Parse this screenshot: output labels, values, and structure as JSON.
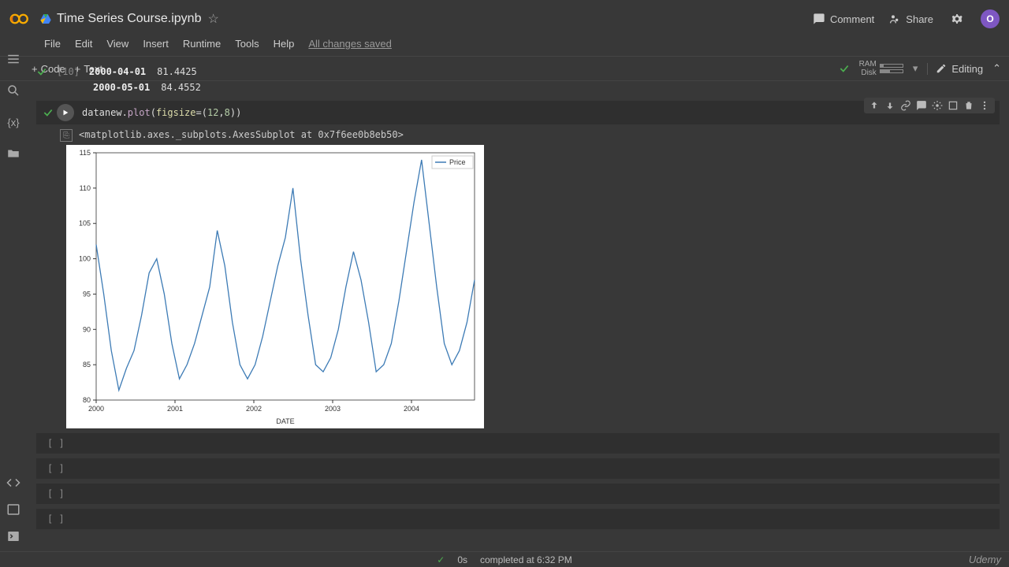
{
  "header": {
    "filename": "Time Series Course.ipynb",
    "comment": "Comment",
    "share": "Share",
    "avatar": "O"
  },
  "menubar": {
    "file": "File",
    "edit": "Edit",
    "view": "View",
    "insert": "Insert",
    "runtime": "Runtime",
    "tools": "Tools",
    "help": "Help",
    "status": "All changes saved"
  },
  "toolbar": {
    "code": "Code",
    "text": "Text",
    "ram": "RAM",
    "disk": "Disk",
    "editing": "Editing"
  },
  "output_rows": [
    {
      "date": "2000-04-01",
      "value": "81.4425"
    },
    {
      "date": "2000-05-01",
      "value": "84.4552"
    }
  ],
  "prev_cell": {
    "exec": "[10]"
  },
  "cell": {
    "code_display": "datanew.plot(figsize=(12,8))",
    "repr": "<matplotlib.axes._subplots.AxesSubplot at 0x7f6ee0b8eb50>"
  },
  "empty_cells": [
    "[ ]",
    "[ ]",
    "[ ]",
    "[ ]"
  ],
  "statusbar": {
    "check": "✓",
    "duration": "0s",
    "completed": "completed at 6:32 PM"
  },
  "watermark": "Udemy",
  "chart_data": {
    "type": "line",
    "xlabel": "DATE",
    "legend": "Price",
    "ylim": [
      80,
      115
    ],
    "yticks": [
      80,
      85,
      90,
      95,
      100,
      105,
      110,
      115
    ],
    "xticks": [
      "2000",
      "2001",
      "2002",
      "2003",
      "2004"
    ],
    "series": [
      {
        "name": "Price",
        "x_fraction": [
          0.0,
          0.02,
          0.04,
          0.06,
          0.08,
          0.1,
          0.12,
          0.14,
          0.16,
          0.18,
          0.2,
          0.22,
          0.24,
          0.26,
          0.28,
          0.3,
          0.32,
          0.34,
          0.36,
          0.38,
          0.4,
          0.42,
          0.44,
          0.46,
          0.48,
          0.5,
          0.52,
          0.54,
          0.56,
          0.58,
          0.6,
          0.62,
          0.64,
          0.66,
          0.68,
          0.7,
          0.72,
          0.74,
          0.76,
          0.78,
          0.8,
          0.82,
          0.84,
          0.86,
          0.88,
          0.9,
          0.92,
          0.94,
          0.96,
          0.98,
          1.0
        ],
        "y": [
          102,
          95,
          87,
          81.4,
          84.5,
          87,
          92,
          98,
          100,
          95,
          88,
          83,
          85,
          88,
          92,
          96,
          104,
          99,
          91,
          85,
          83,
          85,
          89,
          94,
          99,
          103,
          110,
          100,
          92,
          85,
          84,
          86,
          90,
          96,
          101,
          97,
          91,
          84,
          85,
          88,
          94,
          101,
          108,
          114,
          105,
          96,
          88,
          85,
          87,
          91,
          97
        ]
      }
    ]
  }
}
